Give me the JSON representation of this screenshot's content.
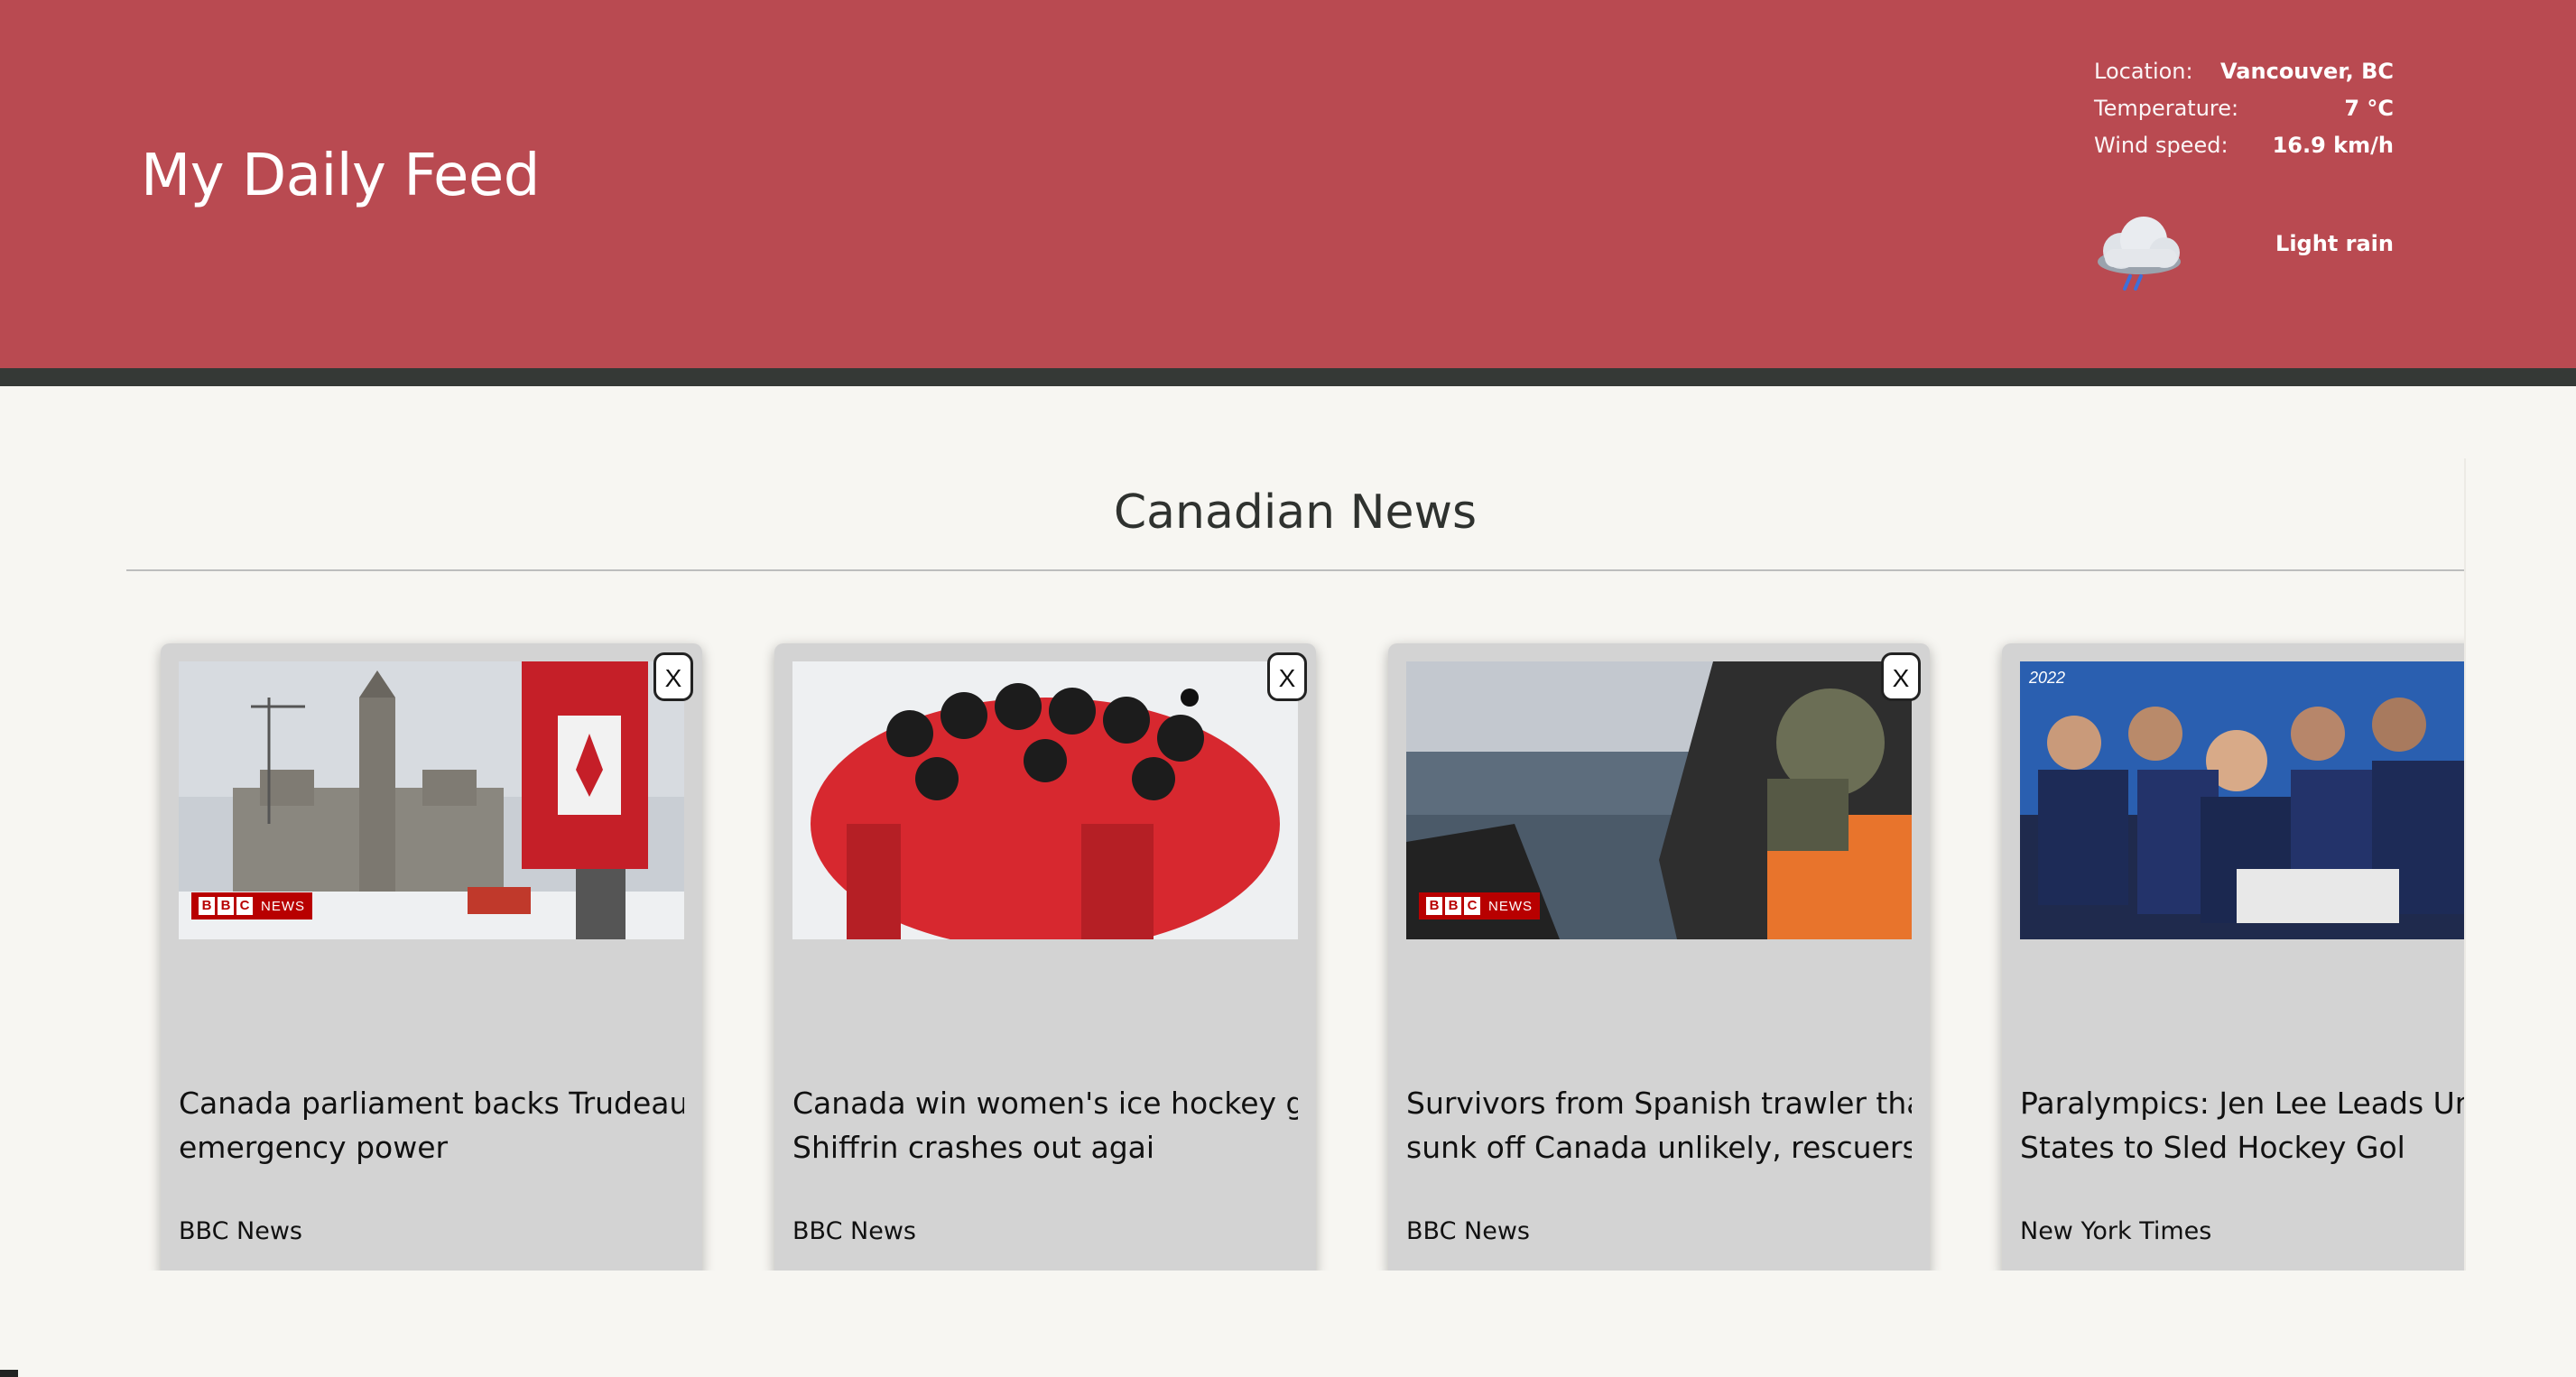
{
  "header": {
    "title": "My Daily Feed",
    "background_color": "#b94a51",
    "border_color": "#353936"
  },
  "weather": {
    "rows": [
      {
        "label": "Location:",
        "value": "Vancouver, BC"
      },
      {
        "label": "Temperature:",
        "value": "7 °C"
      },
      {
        "label": "Wind speed:",
        "value": "16.9 km/h"
      }
    ],
    "condition": "Light rain",
    "condition_icon": "rain-cloud-icon"
  },
  "section": {
    "title": "Canadian News"
  },
  "cards": [
    {
      "title_line1": "Canada parliament backs Trudeau on",
      "title_line2": "emergency power",
      "source": "BBC News",
      "close_label": "X",
      "badge": {
        "letters": [
          "B",
          "B",
          "C"
        ],
        "text": "NEWS"
      }
    },
    {
      "title_line1": "Canada win women's ice hockey gold,",
      "title_line2": "Shiffrin crashes out agai",
      "source": "BBC News",
      "close_label": "X"
    },
    {
      "title_line1": "Survivors from Spanish trawler that",
      "title_line2": "sunk off Canada unlikely, rescuers sa",
      "source": "BBC News",
      "close_label": "X",
      "badge": {
        "letters": [
          "B",
          "B",
          "C"
        ],
        "text": "NEWS"
      }
    },
    {
      "title_line1": "Paralympics: Jen Lee Leads United",
      "title_line2": "States to Sled Hockey Gol",
      "source": "New York Times",
      "image_caption": "2022"
    }
  ]
}
